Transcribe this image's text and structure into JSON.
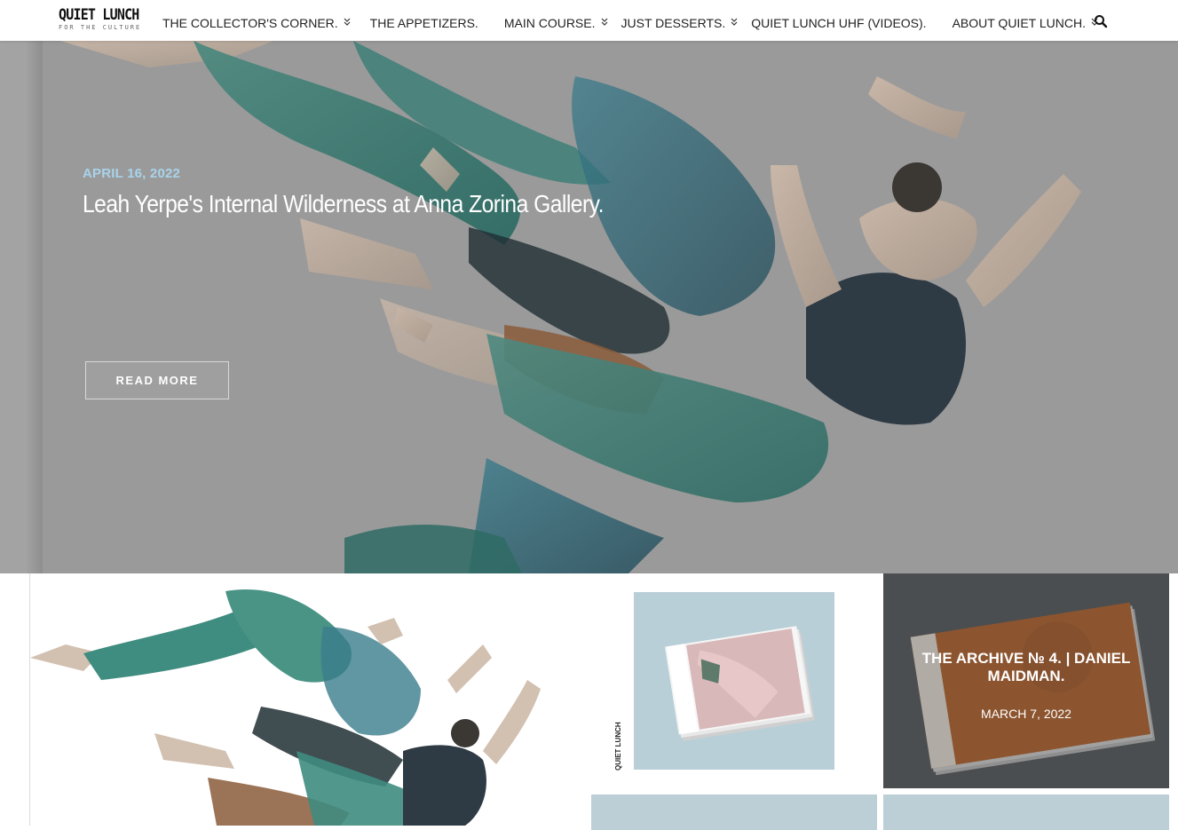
{
  "site": {
    "logo_title": "QUIET LUNCH",
    "logo_subtitle": "FOR THE CULTURE"
  },
  "nav": {
    "items": [
      {
        "label": "THE COLLECTOR'S CORNER.",
        "dropdown": true
      },
      {
        "label": "THE APPETIZERS.",
        "dropdown": false
      },
      {
        "label": "MAIN COURSE.",
        "dropdown": true
      },
      {
        "label": "JUST DESSERTS.",
        "dropdown": true
      },
      {
        "label": "QUIET LUNCH UHF (VIDEOS).",
        "dropdown": false
      },
      {
        "label": "ABOUT QUIET LUNCH.",
        "dropdown": true
      }
    ],
    "search_icon": "search-icon"
  },
  "hero": {
    "date": "APRIL 16, 2022",
    "title": "Leah Yerpe's Internal Wilderness at Anna Zorina Gallery.",
    "button_label": "READ MORE"
  },
  "cards": {
    "magazine_spine": "QUIET LUNCH",
    "archive_title": "THE ARCHIVE № 4. | DANIEL MAIDMAN.",
    "archive_date": "MARCH 7, 2022"
  },
  "colors": {
    "accent_date": "#a9d3ea",
    "hero_overlay": "#9a9a9a",
    "archive_bg": "#55595c"
  }
}
